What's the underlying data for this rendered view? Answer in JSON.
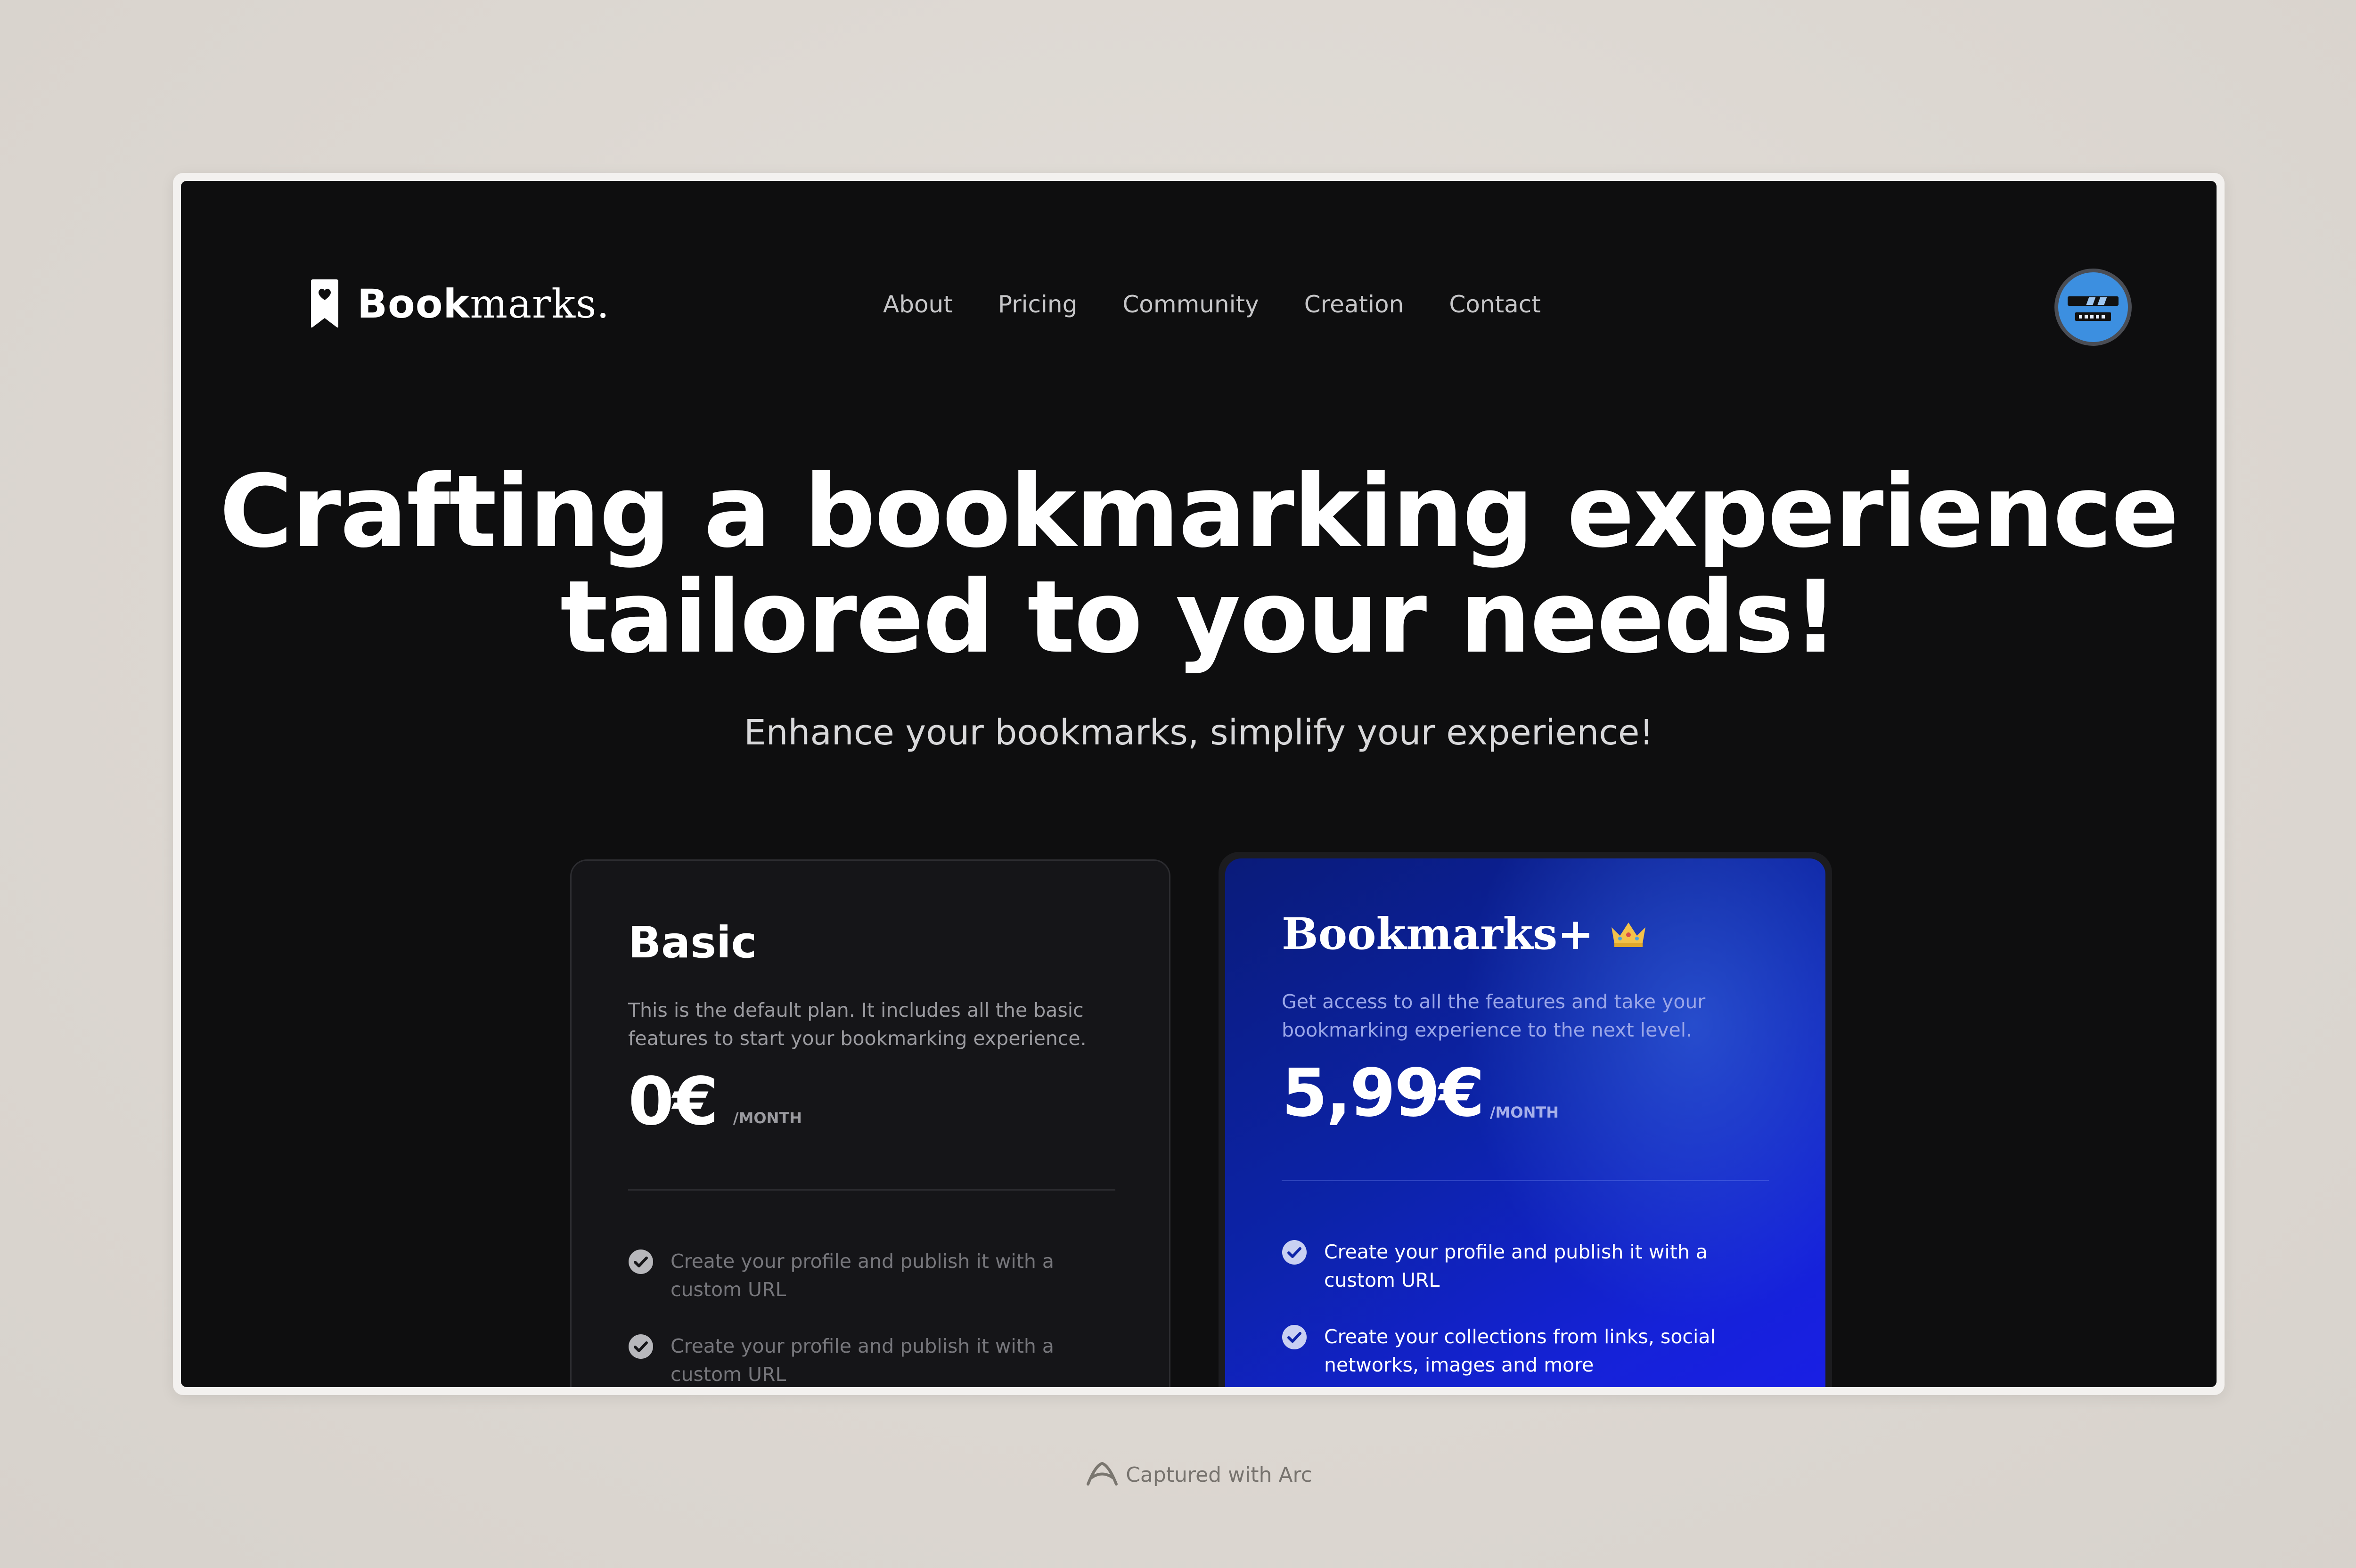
{
  "brand": {
    "bold": "Book",
    "serif": "marks.",
    "logo_icon": "bookmark-heart-icon"
  },
  "nav": {
    "items": [
      "About",
      "Pricing",
      "Community",
      "Creation",
      "Contact"
    ]
  },
  "user": {
    "avatar_icon": "robot-avatar-icon"
  },
  "hero": {
    "title_line1": "Crafting a bookmarking experience",
    "title_line2": "tailored to your needs!",
    "subtitle": "Enhance your bookmarks, simplify your experience!"
  },
  "plans": {
    "basic": {
      "name": "Basic",
      "description": "This is the default plan. It includes all the basic features to start your bookmarking experience.",
      "price": "0€",
      "period": "/MONTH",
      "features": [
        "Create your profile and publish it with a custom URL",
        "Create your profile and publish it with a custom URL"
      ]
    },
    "plus": {
      "name": "Bookmarks+",
      "badge_icon": "crown-icon",
      "description": "Get access to all the features and take your bookmarking experience to the next level.",
      "price": "5,99€",
      "period": "/MONTH",
      "features": [
        "Create your profile and publish it with a custom URL",
        "Create your collections from links, social networks, images and more"
      ]
    }
  },
  "footer": {
    "captured": "Captured with Arc",
    "icon": "arc-icon"
  },
  "colors": {
    "window_bg": "#0e0e0f",
    "plus_gradient_start": "#0a1b7a",
    "plus_gradient_end": "#1a1ee6",
    "avatar_bg": "#3c8fe0"
  }
}
